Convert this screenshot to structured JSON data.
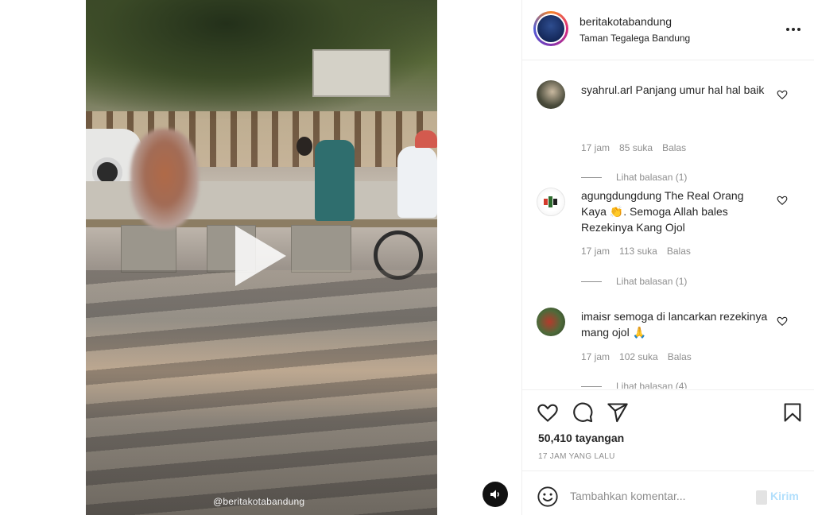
{
  "post": {
    "username": "beritakotabandung",
    "location": "Taman Tegalega Bandung",
    "watermark": "@beritakotabandung"
  },
  "comments": [
    {
      "user": "syahrul.arl",
      "text": "Panjang umur hal hal baik",
      "time": "17 jam",
      "likes": "85 suka",
      "reply": "Balas",
      "replies": "Lihat balasan (1)"
    },
    {
      "user": "agungdungdung",
      "text": "The Real Orang Kaya 👏. Semoga Allah bales Rezekinya Kang Ojol",
      "time": "17 jam",
      "likes": "113 suka",
      "reply": "Balas",
      "replies": "Lihat balasan (1)"
    },
    {
      "user": "imaisr",
      "text": "semoga di lancarkan rezekinya mang ojol 🙏",
      "time": "17 jam",
      "likes": "102 suka",
      "reply": "Balas",
      "replies": "Lihat balasan (4)"
    }
  ],
  "stats": {
    "views": "50,410 tayangan",
    "time_ago": "17 JAM YANG LALU"
  },
  "compose": {
    "placeholder": "Tambahkan komentar...",
    "post_label": "Kirim"
  },
  "icons": {
    "like": "heart-icon",
    "comment": "comment-icon",
    "share": "share-icon",
    "save": "bookmark-icon",
    "more": "more-icon",
    "emoji": "emoji-icon",
    "sound": "speaker-icon",
    "play": "play-icon"
  },
  "colors": {
    "text": "#262626",
    "muted": "#8e8e8e",
    "post_button_disabled": "#b2dffc",
    "border": "#efefef"
  }
}
